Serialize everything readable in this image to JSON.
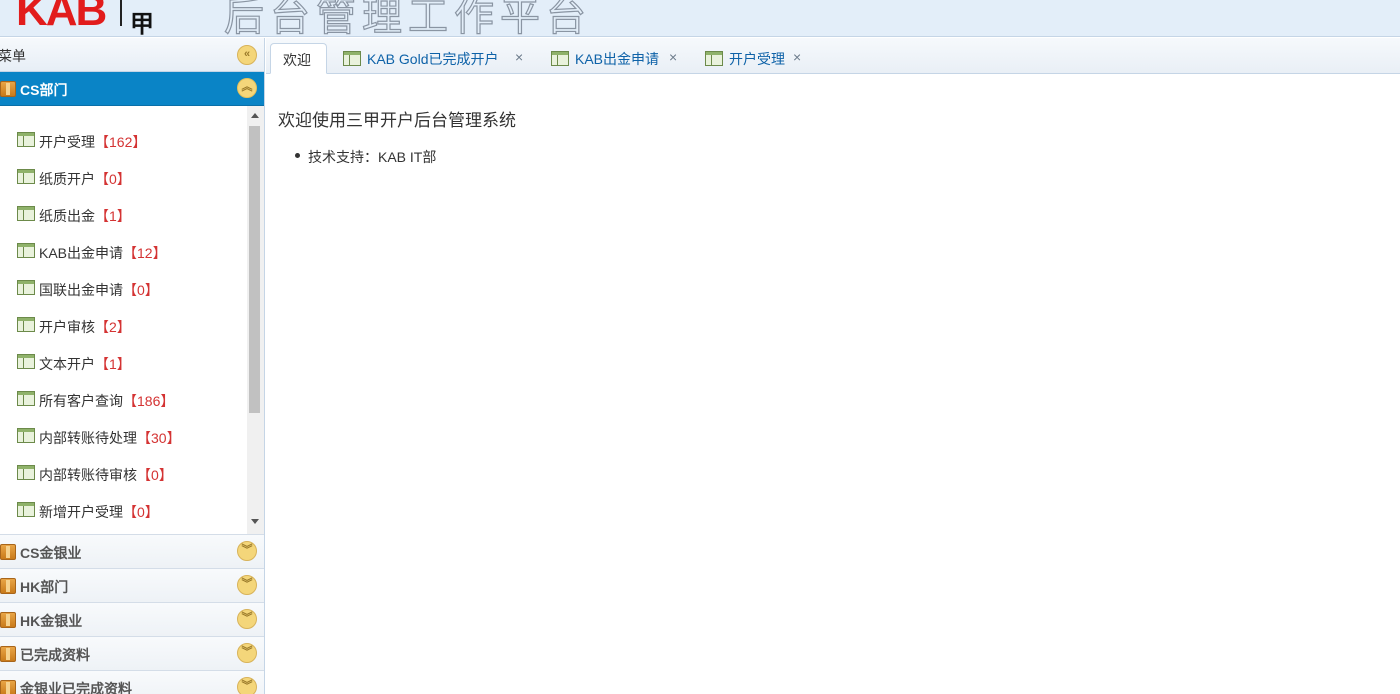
{
  "header": {
    "logo_text": "KAB",
    "logo_mark": "甲",
    "title": "后台管理工作平台"
  },
  "sidebar": {
    "title": "菜单",
    "groups": [
      {
        "label": "CS部门",
        "expanded": true,
        "items": [
          {
            "label": "开户受理",
            "count": "162"
          },
          {
            "label": "纸质开户",
            "count": "0"
          },
          {
            "label": "纸质出金",
            "count": "1"
          },
          {
            "label": "KAB出金申请",
            "count": "12"
          },
          {
            "label": "国联出金申请",
            "count": "0"
          },
          {
            "label": "开户审核",
            "count": "2"
          },
          {
            "label": "文本开户",
            "count": "1"
          },
          {
            "label": "所有客户查询",
            "count": "186"
          },
          {
            "label": "内部转账待处理",
            "count": "30"
          },
          {
            "label": "内部转账待审核",
            "count": "0"
          },
          {
            "label": "新增开户受理",
            "count": "0"
          }
        ]
      },
      {
        "label": "CS金银业"
      },
      {
        "label": "HK部门"
      },
      {
        "label": "HK金银业"
      },
      {
        "label": "已完成资料"
      },
      {
        "label": "金银业已完成资料"
      }
    ],
    "bracket_left": "【",
    "bracket_right": "】"
  },
  "tabs": [
    {
      "label": "欢迎",
      "active": true
    },
    {
      "label": "KAB Gold已完成开户"
    },
    {
      "label": "KAB出金申请"
    },
    {
      "label": "开户受理"
    }
  ],
  "tab_close_glyph": "×",
  "main": {
    "welcome_title": "欢迎使用三甲开户后台管理系统",
    "support_text": "技术支持：KAB IT部"
  },
  "icons": {
    "collapse": "double-chevron-left-icon",
    "expand": "double-chevron-down-icon",
    "collapse_group": "double-chevron-up-icon",
    "folder": "folder-icon",
    "document": "grid-document-icon"
  },
  "colors": {
    "active_group_bg": "#0a84c6",
    "count_red": "#d43333",
    "logo_red": "#e21c1c",
    "header_bg": "#e3eef9",
    "link_blue": "#0e62a8"
  }
}
